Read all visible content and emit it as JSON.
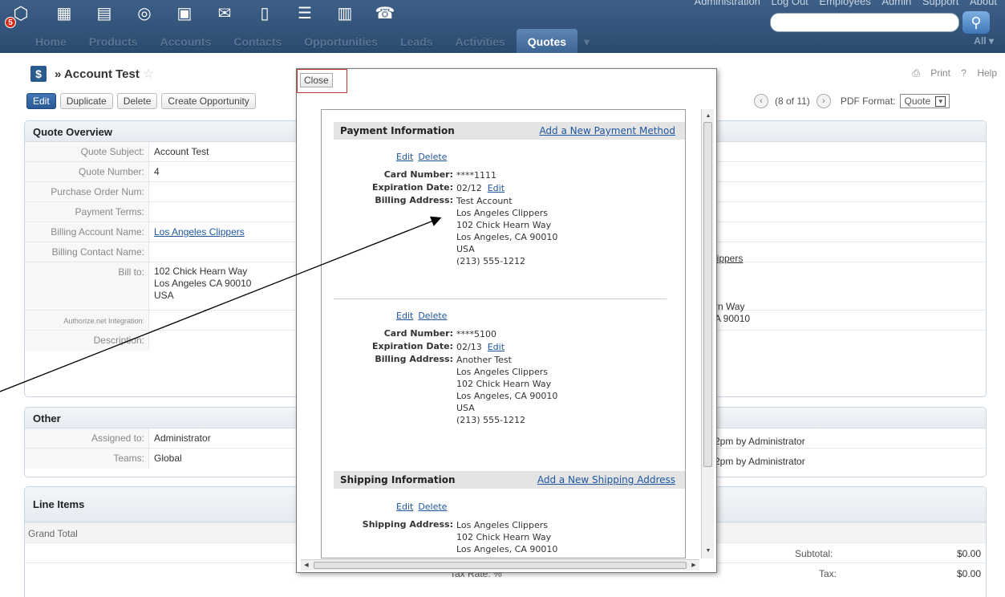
{
  "top_links": [
    "Administration",
    "Log Out",
    "Employees",
    "Admin",
    "Support",
    "About"
  ],
  "nav_tabs": [
    "Home",
    "Products",
    "Accounts",
    "Contacts",
    "Opportunities",
    "Leads",
    "Activities",
    "Quotes"
  ],
  "notification_count": "5",
  "search_scope": "All",
  "record": {
    "title": "» Account Test",
    "print": "Print",
    "help": "Help",
    "actions": [
      "Edit",
      "Duplicate",
      "Delete",
      "Create Opportunity"
    ],
    "pager": "(8 of 11)",
    "pdf_label": "PDF Format:",
    "pdf_value": "Quote"
  },
  "overview": {
    "heading": "Quote Overview",
    "rows": [
      {
        "label": "Quote Subject:",
        "value": "Account Test"
      },
      {
        "label": "Quote Number:",
        "value": "4"
      },
      {
        "label": "Purchase Order Num:",
        "value": ""
      },
      {
        "label": "Payment Terms:",
        "value": ""
      },
      {
        "label": "Billing Account Name:",
        "value": "Los Angeles Clippers"
      },
      {
        "label": "Billing Contact Name:",
        "value": ""
      },
      {
        "label": "Bill to:",
        "value": "102 Chick Hearn Way"
      },
      {
        "label": "Authorize.net Integration:",
        "value": ""
      },
      {
        "label": "Description:",
        "value": ""
      }
    ],
    "bill_to_line2": "Los Angeles CA  90010",
    "bill_to_line3": "USA",
    "right_account": "lippers",
    "right_addr1": "rn Way",
    "right_addr2": "A  90010"
  },
  "other": {
    "heading": "Other",
    "assigned_label": "Assigned to:",
    "assigned_value": "Administrator",
    "teams_label": "Teams:",
    "teams_value": "Global",
    "right1": "2pm by Administrator",
    "right2": "2pm by Administrator"
  },
  "line_items": {
    "heading": "Line Items",
    "grand_total": "Grand Total",
    "subtotal_label": "Subtotal:",
    "subtotal_value": "$0.00",
    "tax_rate": "Tax Rate:  %",
    "tax_label": "Tax:",
    "tax_value": "$0.00"
  },
  "popup": {
    "close": "Close",
    "payment_heading": "Payment Information",
    "add_payment": "Add a New Payment Method",
    "edit": "Edit",
    "delete": "Delete",
    "card_number_label": "Card Number:",
    "expiration_label": "Expiration Date:",
    "billing_address_label": "Billing Address:",
    "cards": [
      {
        "number": "****1111",
        "expiration": "02/12",
        "address": [
          "Test Account",
          "Los Angeles Clippers",
          "102 Chick Hearn Way",
          "Los Angeles, CA 90010",
          "USA",
          "(213) 555-1212"
        ]
      },
      {
        "number": "****5100",
        "expiration": "02/13",
        "address": [
          "Another Test",
          "Los Angeles Clippers",
          "102 Chick Hearn Way",
          "Los Angeles, CA 90010",
          "USA",
          "(213) 555-1212"
        ]
      }
    ],
    "shipping_heading": "Shipping Information",
    "add_shipping": "Add a New Shipping Address",
    "shipping_label": "Shipping Address:",
    "shipping_address": [
      "Los Angeles Clippers",
      "102 Chick Hearn Way",
      "Los Angeles, CA 90010"
    ]
  }
}
